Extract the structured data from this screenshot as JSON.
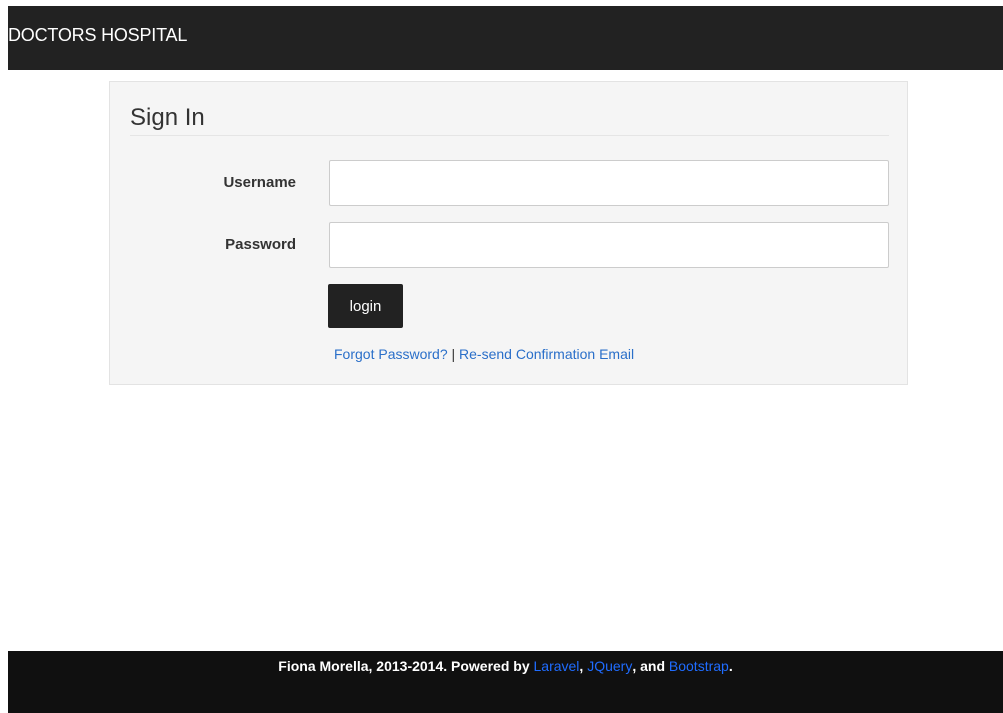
{
  "navbar": {
    "brand": "DOCTORS HOSPITAL"
  },
  "signin": {
    "title": "Sign In",
    "username_label": "Username",
    "username_value": "",
    "password_label": "Password",
    "password_value": "",
    "login_label": "login",
    "forgot_password": "Forgot Password?",
    "separator": "|",
    "resend_confirmation": "Re-send Confirmation Email"
  },
  "footer": {
    "prefix": "Fiona Morella, 2013-2014. Powered by ",
    "link_laravel": "Laravel",
    "comma": ", ",
    "link_jquery": "JQuery",
    "and": ", and ",
    "link_bootstrap": "Bootstrap",
    "suffix": "."
  },
  "colors": {
    "navbar_bg": "#222222",
    "footer_bg": "#101010",
    "link": "#2a6fc9",
    "footer_link": "#1f6cff",
    "well_bg": "#f5f5f5"
  }
}
